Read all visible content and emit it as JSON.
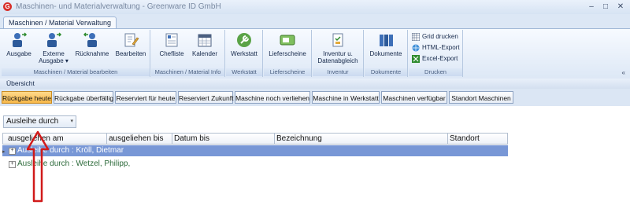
{
  "titlebar": {
    "title": "Maschinen- und Materialverwaltung - Greenware ID GmbH",
    "min": "–",
    "max": "□",
    "close": "✕"
  },
  "tabs": {
    "active": "Maschinen / Material Verwaltung"
  },
  "ribbon": {
    "groups": {
      "bearbeiten": "Maschinen / Material bearbeiten",
      "info": "Maschinen / Material Info",
      "werkstatt": "Werkstatt",
      "lieferscheine": "Lieferscheine",
      "inventur": "Inventur",
      "dokumente": "Dokumente",
      "drucken": "Drucken"
    },
    "buttons": {
      "ausgabe": "Ausgabe",
      "externe_ausgabe_1": "Externe",
      "externe_ausgabe_2": "Ausgabe ▾",
      "ruecknahme": "Rücknahme",
      "bearbeiten": "Bearbeiten",
      "chefliste": "Chefliste",
      "kalender": "Kalender",
      "werkstatt": "Werkstatt",
      "lieferscheine": "Lieferscheine",
      "inventur_1": "Inventur u.",
      "inventur_2": "Datenabgleich",
      "dokumente": "Dokumente",
      "grid_drucken": "Grid drucken",
      "html_export": "HTML-Export",
      "excel_export": "Excel-Export"
    },
    "collapse": "«"
  },
  "uebersicht": "Übersicht",
  "filter_buttons": [
    "Rückgabe heute",
    "Rückgabe überfällig",
    "Reserviert für heute",
    "Reserviert Zukunft",
    "Maschine noch verliehen",
    "Maschine in Werkstatt",
    "Maschinen verfügbar",
    "Standort Maschinen"
  ],
  "group_by": {
    "value": "Ausleihe durch",
    "caret": "▾"
  },
  "grid": {
    "columns": [
      "ausgeliehen am",
      "ausgeliehen bis",
      "Datum bis",
      "Bezeichnung",
      "Standort"
    ],
    "rows": [
      {
        "text": "Ausleihe durch : Kröll, Dietmar",
        "selected": true
      },
      {
        "text": "Ausleihe durch : Wetzel, Philipp,",
        "selected": false
      }
    ]
  },
  "colors": {
    "active_filter": "#f7b84a",
    "selected_row": "#7897d6",
    "annotation_arrow": "#d11a1a"
  }
}
